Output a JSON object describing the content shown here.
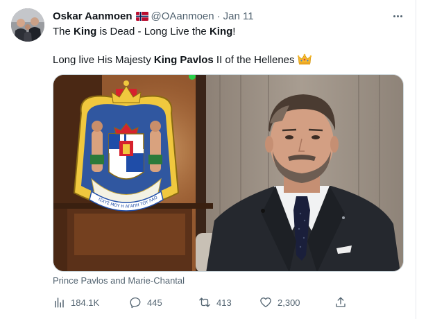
{
  "tweet": {
    "display_name": "Oskar Aanmoen",
    "flag_icon": "norway-flag-icon",
    "handle": "@OAanmoen",
    "separator": "·",
    "date": "Jan 11",
    "line1": {
      "part1": "The ",
      "bold1": "King",
      "part2": " is Dead - Long Live the ",
      "bold2": "King",
      "part3": "!"
    },
    "line2": {
      "part1": "Long live His Majesty ",
      "bold": "King Pavlos",
      "part2": " II of the Hellenes",
      "emoji_icon": "crown-icon"
    },
    "media": {
      "motto": "ΙΣΧΥΣ ΜΟΥ Η ΑΓΑΠΗ ΤΟΥ ΛΑΟΥ"
    },
    "caption": "Prince Pavlos and Marie-Chantal",
    "actions": {
      "views": "184.1K",
      "replies": "445",
      "retweets": "413",
      "likes": "2,300"
    }
  },
  "colors": {
    "text_primary": "#0f1419",
    "text_secondary": "#536471",
    "border": "#cfd9de"
  }
}
